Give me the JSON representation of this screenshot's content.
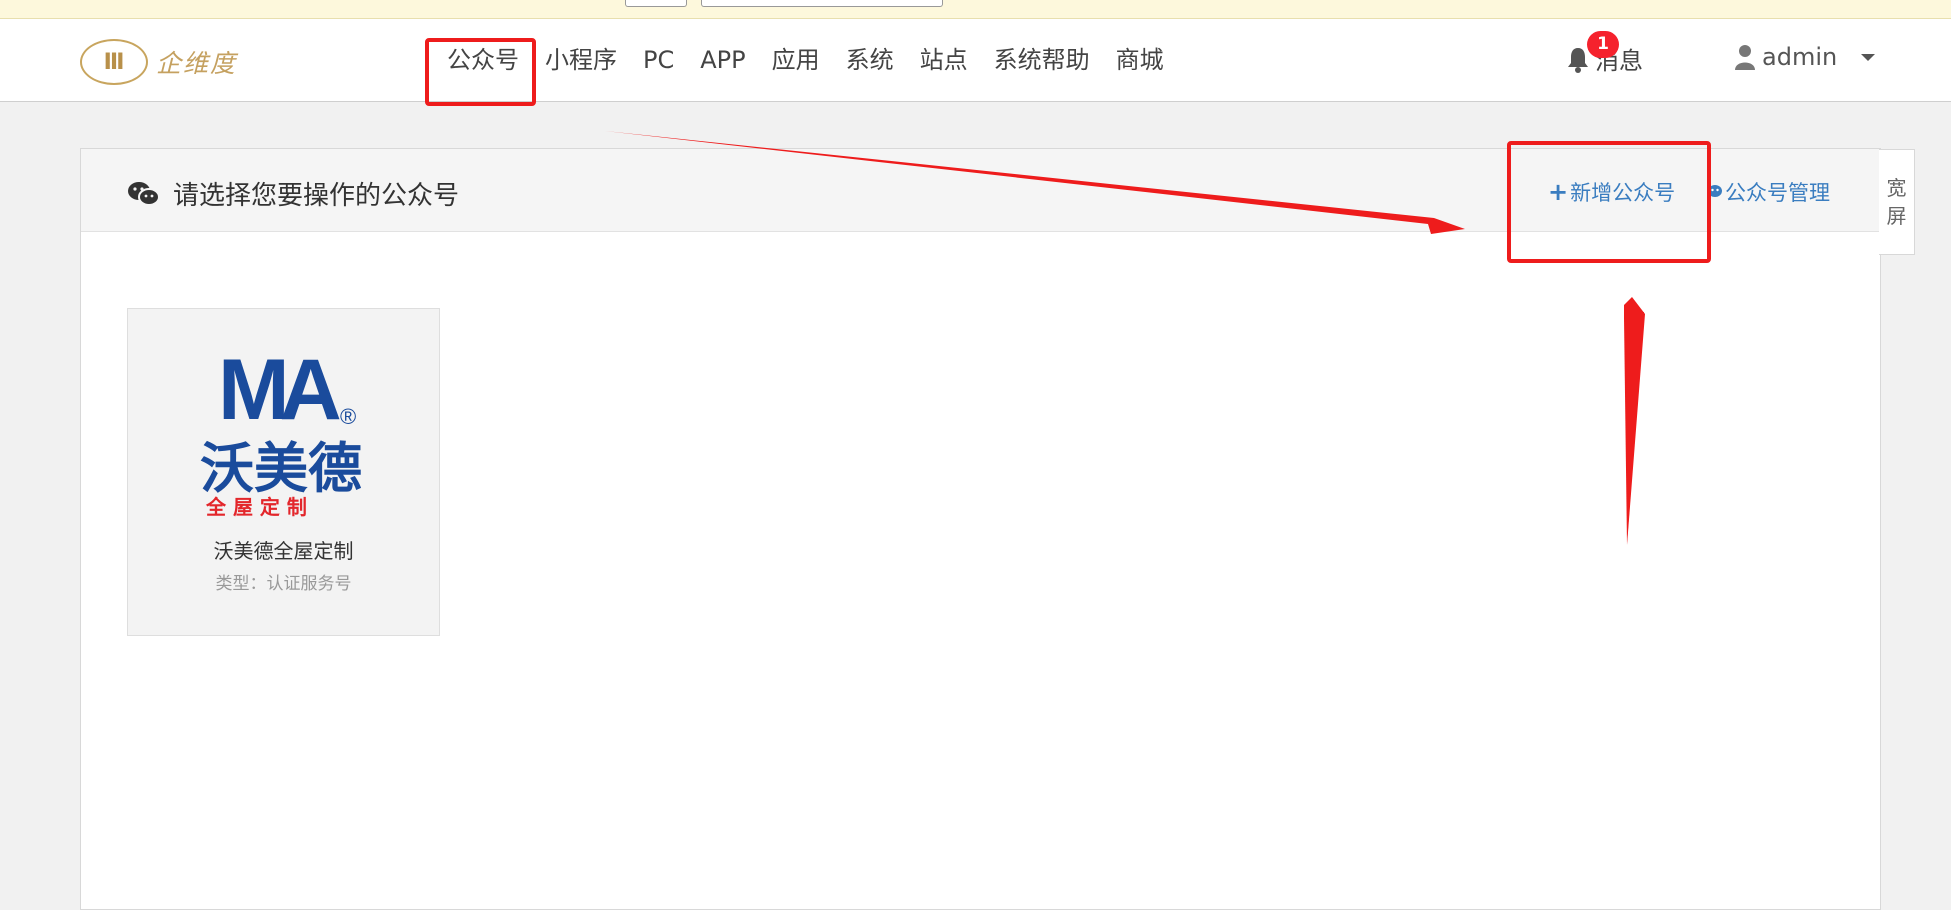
{
  "topbar": {},
  "brand": {
    "logo_glyph": "Ⅲ",
    "logo_text": "企维度"
  },
  "nav": {
    "items": [
      {
        "label": "公众号"
      },
      {
        "label": "小程序"
      },
      {
        "label": "PC"
      },
      {
        "label": "APP"
      },
      {
        "label": "应用"
      },
      {
        "label": "系统"
      },
      {
        "label": "站点"
      },
      {
        "label": "系统帮助"
      },
      {
        "label": "商城"
      }
    ]
  },
  "notifications": {
    "badge_count": "1",
    "label": "消息"
  },
  "user": {
    "name": "admin"
  },
  "panel": {
    "title": "请选择您要操作的公众号",
    "add_label": "新增公众号",
    "manage_label": "公众号管理"
  },
  "side_tab": {
    "line1": "宽",
    "line2": "屏"
  },
  "accounts": [
    {
      "logo_letters": "MA",
      "logo_reg": "®",
      "logo_brand": "沃美德",
      "logo_sub": "全 屋 定 制",
      "name": "沃美德全屋定制",
      "type": "类型：认证服务号"
    }
  ],
  "colors": {
    "link": "#3a7dc0",
    "annotation": "#ee1c1c",
    "badge": "#f5222d",
    "brand_blue": "#1a4b9c",
    "brand_red": "#e3262b"
  }
}
